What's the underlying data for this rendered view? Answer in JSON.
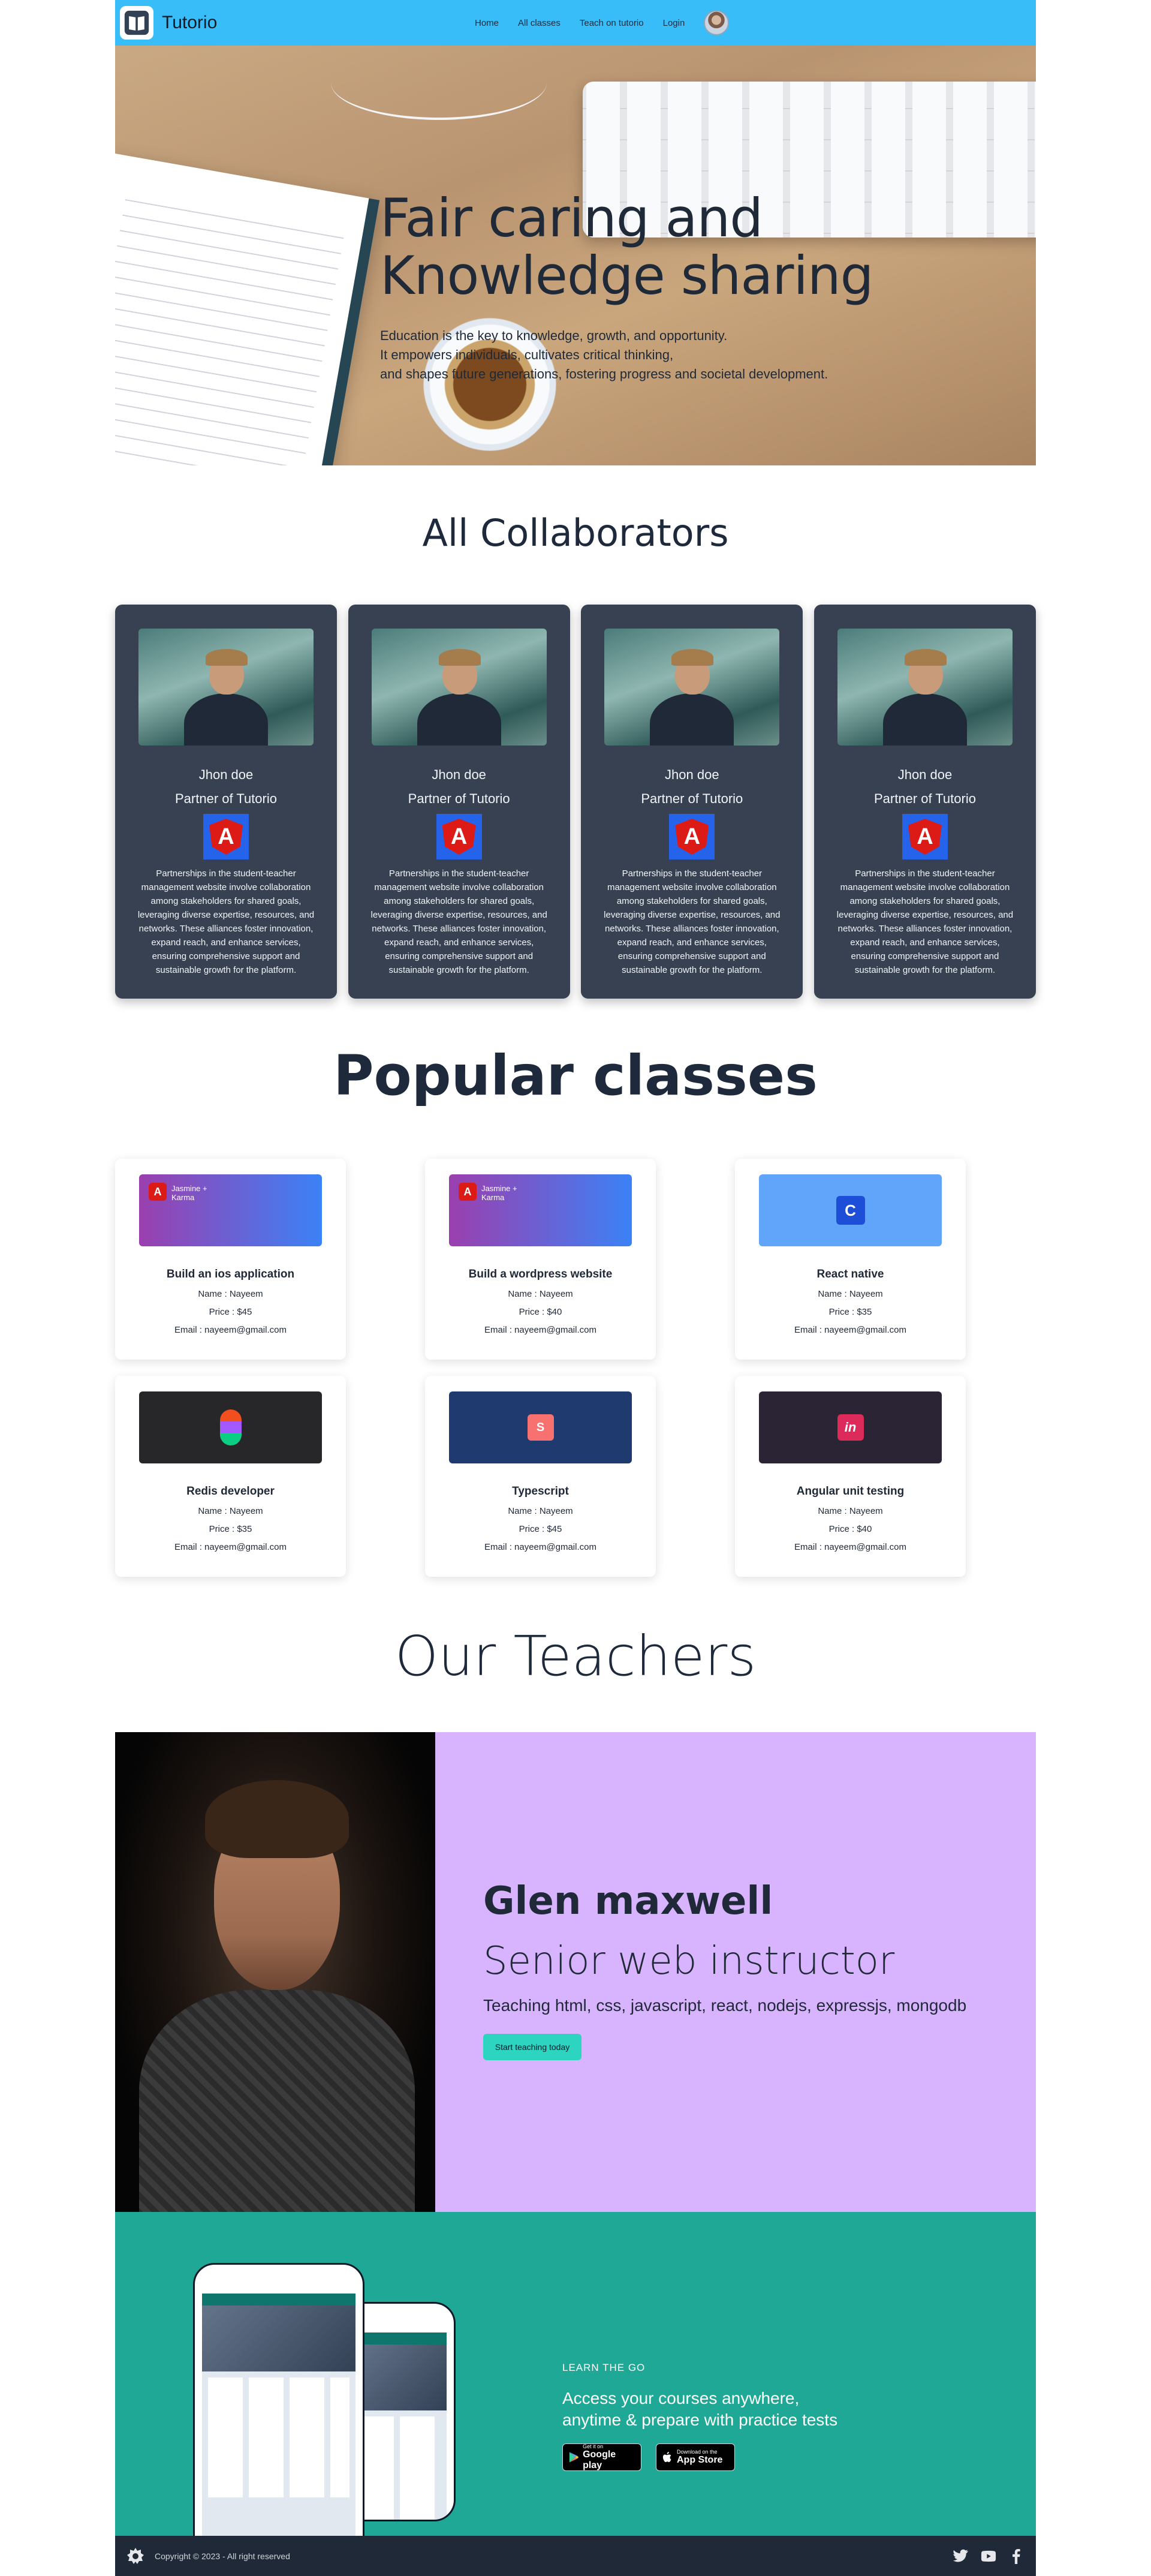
{
  "nav": {
    "brand": "Tutorio",
    "links": [
      "Home",
      "All classes",
      "Teach on tutorio",
      "Login"
    ]
  },
  "hero": {
    "title_line1": "Fair caring and",
    "title_line2": "Knowledge sharing",
    "text_line1": "Education is the key to knowledge, growth, and opportunity.",
    "text_line2": "It empowers individuals, cultivates critical thinking,",
    "text_line3": "and shapes future generations, fostering progress and societal development."
  },
  "collaborators": {
    "title": "All Collaborators",
    "cards": [
      {
        "name": "Jhon doe",
        "role": "Partner of Tutorio",
        "logo": "A",
        "desc": "Partnerships in the student-teacher management website involve collaboration among stakeholders for shared goals, leveraging diverse expertise, resources, and networks. These alliances foster innovation, expand reach, and enhance services, ensuring comprehensive support and sustainable growth for the platform."
      },
      {
        "name": "Jhon doe",
        "role": "Partner of Tutorio",
        "logo": "A",
        "desc": "Partnerships in the student-teacher management website involve collaboration among stakeholders for shared goals, leveraging diverse expertise, resources, and networks. These alliances foster innovation, expand reach, and enhance services, ensuring comprehensive support and sustainable growth for the platform."
      },
      {
        "name": "Jhon doe",
        "role": "Partner of Tutorio",
        "logo": "A",
        "desc": "Partnerships in the student-teacher management website involve collaboration among stakeholders for shared goals, leveraging diverse expertise, resources, and networks. These alliances foster innovation, expand reach, and enhance services, ensuring comprehensive support and sustainable growth for the platform."
      },
      {
        "name": "Jhon doe",
        "role": "Partner of Tutorio",
        "logo": "A",
        "desc": "Partnerships in the student-teacher management website involve collaboration among stakeholders for shared goals, leveraging diverse expertise, resources, and networks. These alliances foster innovation, expand reach, and enhance services, ensuring comprehensive support and sustainable growth for the platform."
      }
    ]
  },
  "classes": {
    "title": "Popular classes",
    "items": [
      {
        "title": "Build an ios application",
        "name": "Name : Nayeem",
        "price": "Price : $45",
        "email": "Email : nayeem@gmail.com",
        "thumb_label": "Jasmine + Karma",
        "icon": "A",
        "color_a": "#9b3fae",
        "color_b": "#3b82f6"
      },
      {
        "title": "Build a wordpress website",
        "name": "Name : Nayeem",
        "price": "Price : $40",
        "email": "Email : nayeem@gmail.com",
        "thumb_label": "Jasmine + Karma",
        "icon": "A",
        "color_a": "#9b3fae",
        "color_b": "#3b82f6"
      },
      {
        "title": "React native",
        "name": "Name : Nayeem",
        "price": "Price : $35",
        "email": "Email : nayeem@gmail.com",
        "thumb_label": "",
        "icon": "C",
        "color_a": "#60a5fa",
        "color_b": "#60a5fa"
      },
      {
        "title": "Redis developer",
        "name": "Name : Nayeem",
        "price": "Price : $35",
        "email": "Email : nayeem@gmail.com",
        "thumb_label": "",
        "icon": "F",
        "color_a": "#27272a",
        "color_b": "#27272a"
      },
      {
        "title": "Typescript",
        "name": "Name : Nayeem",
        "price": "Price : $45",
        "email": "Email : nayeem@gmail.com",
        "thumb_label": "",
        "icon": "S",
        "color_a": "#1e3a6e",
        "color_b": "#1e3a6e"
      },
      {
        "title": "Angular unit testing",
        "name": "Name : Nayeem",
        "price": "Price : $40",
        "email": "Email : nayeem@gmail.com",
        "thumb_label": "",
        "icon": "in",
        "color_a": "#2b2435",
        "color_b": "#2b2435"
      }
    ]
  },
  "teachers": {
    "title": "Our Teachers",
    "name": "Glen maxwell",
    "role": "Senior web instructor",
    "skills": "Teaching html, css, javascript, react, nodejs, expressjs, mongodb",
    "button": "Start teaching today"
  },
  "app": {
    "eyebrow": "LEARN THE GO",
    "text_line1": "Access your courses anywhere,",
    "text_line2": "anytime & prepare with practice tests",
    "google_small": "Get it on",
    "google_big": "Google play",
    "apple_small": "Download on the",
    "apple_big": "App Store"
  },
  "footer": {
    "copyright": "Copyright © 2023 - All right reserved"
  },
  "colors": {
    "nav": "#38bdf8",
    "card_dark": "#374151",
    "teacher_bg": "#d8b4fe",
    "app_bg": "#1fa896",
    "footer_bg": "#1f2937",
    "button": "#2dd4bf"
  }
}
